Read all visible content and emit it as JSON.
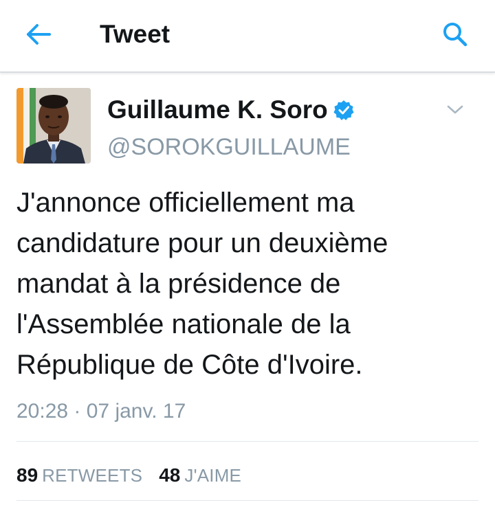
{
  "header": {
    "title": "Tweet",
    "back_icon": "arrow-left-icon",
    "search_icon": "search-icon",
    "accent_color": "#1da1f2"
  },
  "tweet": {
    "author_name": "Guillaume K. Soro",
    "author_handle": "@SOROKGUILLAUME",
    "verified": true,
    "text": "J'annonce officiellement ma\ncandidature pour un deuxième\nmandat à la présidence de\nl'Assemblée nationale de la\nRépublique de Côte d'Ivoire.",
    "timestamp": "20:28 · 07 janv. 17",
    "retweets_count": "89",
    "retweets_label": "RETWEETS",
    "likes_count": "48",
    "likes_label": "J'AIME"
  },
  "colors": {
    "text_primary": "#14171a",
    "text_secondary": "#8899a6",
    "verified_badge": "#1da1f2",
    "divider": "#e1e8ed"
  }
}
